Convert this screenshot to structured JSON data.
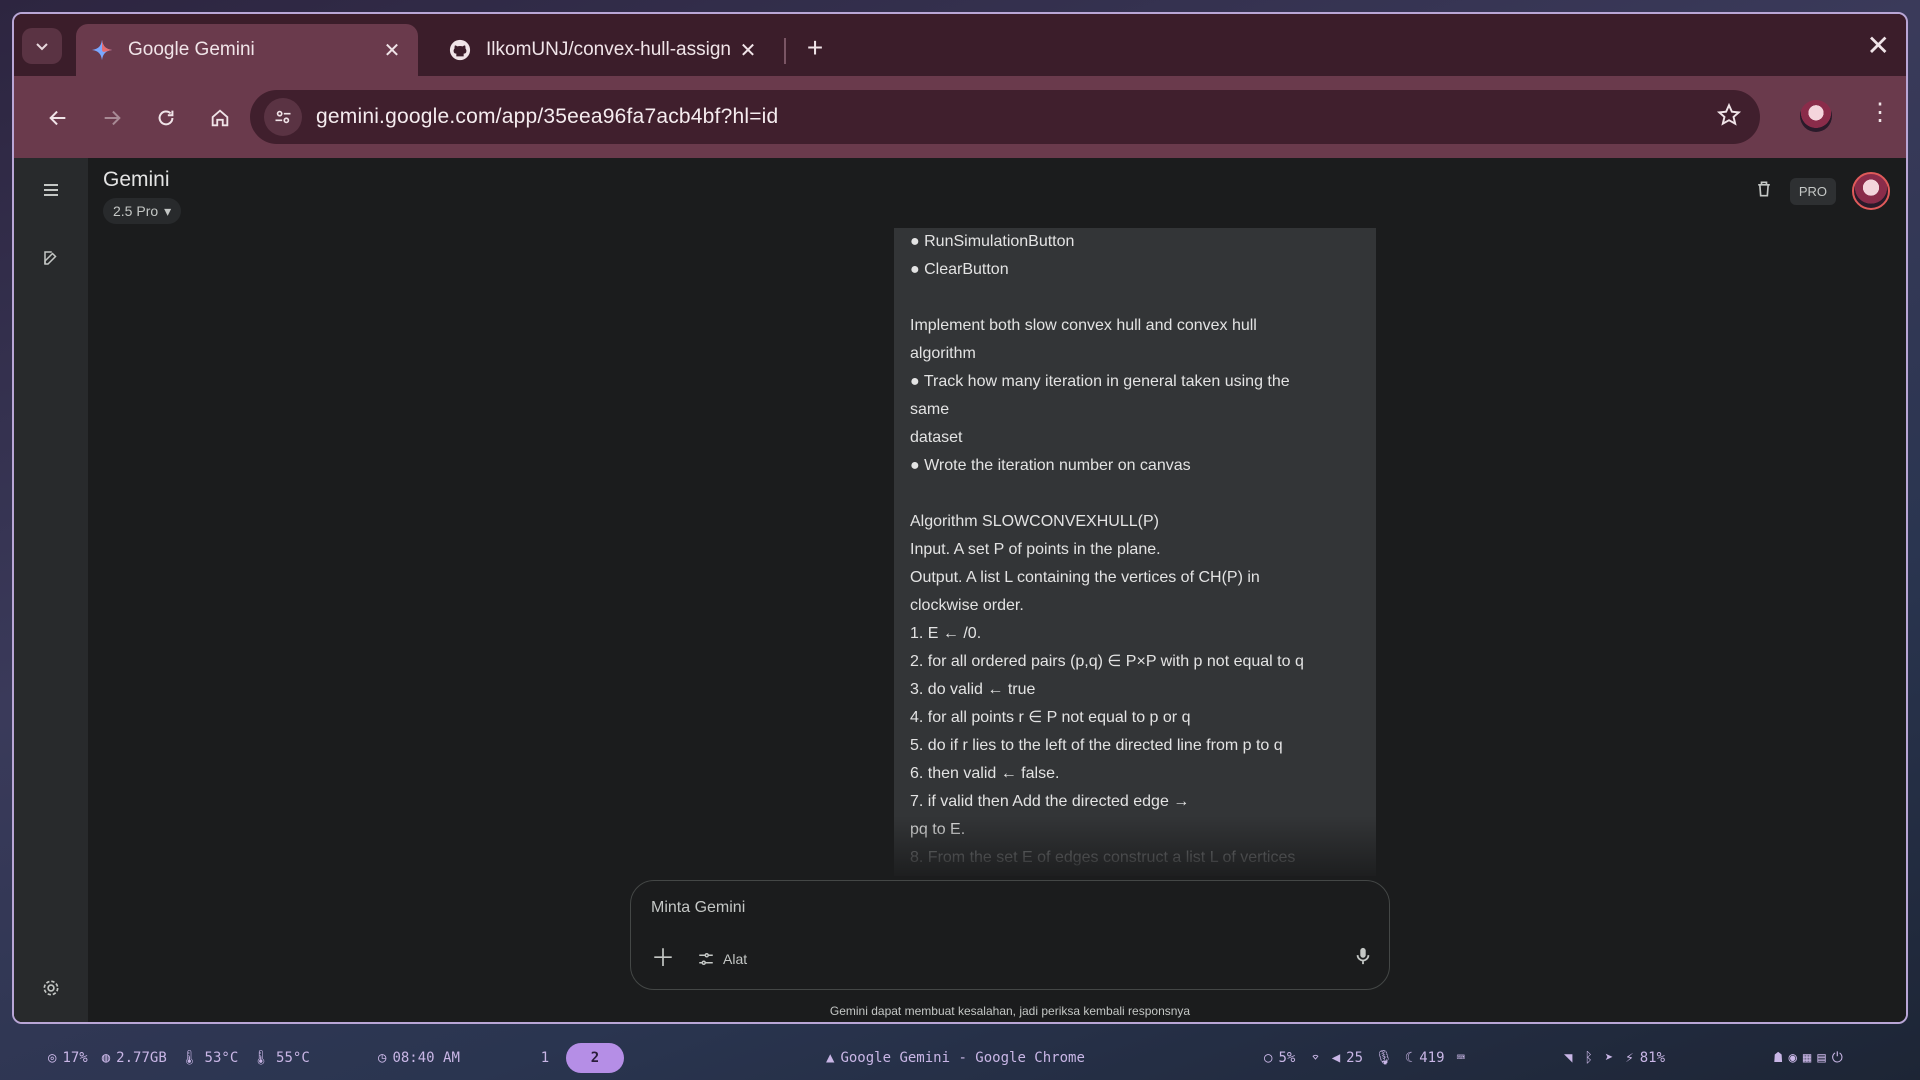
{
  "browser": {
    "tabs": [
      {
        "title": "Google Gemini",
        "active": true,
        "icon": "gemini-sparkle-icon"
      },
      {
        "title": "IlkomUNJ/convex-hull-assign",
        "active": false,
        "icon": "github-icon"
      }
    ],
    "url": "gemini.google.com/app/35eea96fa7acb4bf?hl=id"
  },
  "app": {
    "brand": "Gemini",
    "model": "2.5 Pro",
    "pro_badge": "PRO"
  },
  "message": {
    "lines": [
      "● RunSimulationButton",
      "● ClearButton",
      "",
      "Implement both slow convex hull and convex hull",
      "algorithm",
      "● Track how many iteration in general taken using the",
      "same",
      "dataset",
      "● Wrote the iteration number on canvas",
      "",
      "Algorithm SLOWCONVEXHULL(P)",
      "Input. A set P of points in the plane.",
      "Output. A list L containing the vertices of CH(P) in",
      "clockwise order.",
      "1. E ← /0.",
      "2. for all ordered pairs (p,q) ∈ P×P with p not equal to q",
      "3. do valid ← true",
      "4. for all points r ∈ P not equal to p or q",
      "5. do if r lies to the left of the directed line from p to q",
      "6. then valid ← false.",
      "7. if valid then Add the directed edge →",
      "pq to E.",
      "8. From the set E of edges construct a list L of vertices"
    ]
  },
  "composer": {
    "placeholder": "Minta Gemini",
    "tools_label": "Alat",
    "disclaimer": "Gemini dapat membuat kesalahan, jadi periksa kembali responsnya"
  },
  "taskbar": {
    "cpu": "17%",
    "memory": "2.77GB",
    "temp1": "53°C",
    "temp2": "55°C",
    "time": "08:40 AM",
    "workspaces": [
      "1",
      "2"
    ],
    "active_workspace": "2",
    "window_title": "Google Gemini - Google Chrome",
    "brightness": "5%",
    "volume": "25",
    "mic_level": "419",
    "battery": "81%"
  }
}
